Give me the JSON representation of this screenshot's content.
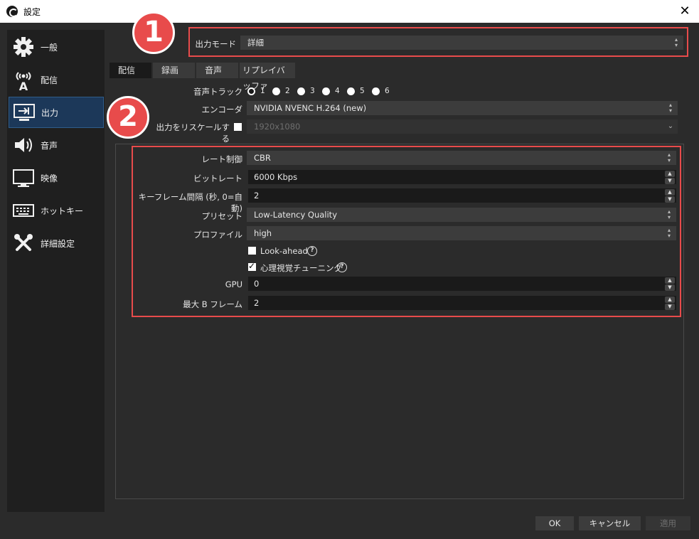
{
  "window": {
    "title": "設定",
    "close_glyph": "✕"
  },
  "sidebar": {
    "items": [
      {
        "label": "一般",
        "icon": "gear-icon"
      },
      {
        "label": "配信",
        "icon": "broadcast-antenna-icon"
      },
      {
        "label": "出力",
        "icon": "output-monitor-icon"
      },
      {
        "label": "音声",
        "icon": "speaker-icon"
      },
      {
        "label": "映像",
        "icon": "monitor-icon"
      },
      {
        "label": "ホットキー",
        "icon": "keyboard-icon"
      },
      {
        "label": "詳細設定",
        "icon": "tools-icon"
      }
    ],
    "active_index": 2
  },
  "output_mode": {
    "label": "出力モード",
    "value": "詳細"
  },
  "tabs": [
    {
      "label": "配信"
    },
    {
      "label": "録画"
    },
    {
      "label": "音声"
    },
    {
      "label": "リプレイバッファ"
    }
  ],
  "active_tab": 0,
  "audio_track": {
    "label": "音声トラック",
    "options": [
      "1",
      "2",
      "3",
      "4",
      "5",
      "6"
    ],
    "selected": "1"
  },
  "encoder": {
    "label": "エンコーダ",
    "value": "NVIDIA NVENC H.264 (new)"
  },
  "rescale": {
    "label": "出力をリスケールする",
    "checked": false,
    "value": "1920x1080"
  },
  "encoder_settings": {
    "rate_control": {
      "label": "レート制御",
      "value": "CBR"
    },
    "bitrate": {
      "label": "ビットレート",
      "value": "6000 Kbps"
    },
    "keyframe_interval": {
      "label": "キーフレーム間隔 (秒, 0=自動)",
      "value": "2"
    },
    "preset": {
      "label": "プリセット",
      "value": "Low-Latency Quality"
    },
    "profile": {
      "label": "プロファイル",
      "value": "high"
    },
    "look_ahead": {
      "label": "Look-ahead",
      "checked": false
    },
    "psycho_visual": {
      "label": "心理視覚チューニング",
      "checked": true
    },
    "gpu": {
      "label": "GPU",
      "value": "0"
    },
    "max_b_frames": {
      "label": "最大 B フレーム",
      "value": "2"
    }
  },
  "annotations": {
    "one": "1",
    "two": "2",
    "color": "#e84b4b"
  },
  "buttons": {
    "ok": "OK",
    "cancel": "キャンセル",
    "apply": "適用"
  },
  "help_glyph": "?",
  "spin_up": "▲",
  "spin_down": "▼",
  "combo_arrow": "▴▾"
}
